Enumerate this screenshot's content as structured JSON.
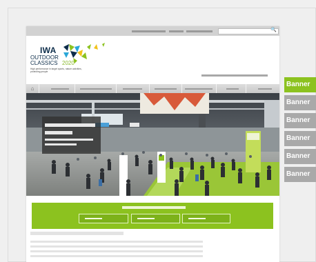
{
  "logo": {
    "line1": "IWA",
    "line2": "OUTDOOR",
    "line3": "CLASSICS",
    "year": "2020",
    "tagline": "High performance in target sports, nature activities, protecting people"
  },
  "search": {
    "icon": "search-icon"
  },
  "nav": {
    "home_icon": "home-icon"
  },
  "banners": [
    "Banner",
    "Banner",
    "Banner",
    "Banner",
    "Banner",
    "Banner"
  ],
  "colors": {
    "accent_green": "#8cc21f",
    "banner_active": "#8cc21f",
    "banner_inactive": "#a9a9a9",
    "brand_navy": "#0d2d4a"
  }
}
